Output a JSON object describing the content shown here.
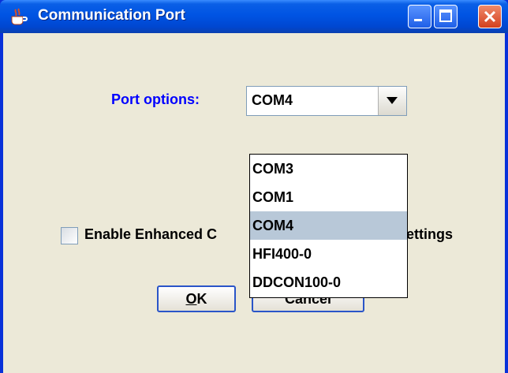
{
  "window": {
    "title": "Communication Port"
  },
  "colors": {
    "title_bar": "#0054e3",
    "port_label": "#0000ff",
    "selected_item": "#b8c8d8",
    "button_border": "#2a55c8"
  },
  "port_options": {
    "label": "Port options:",
    "selected_value": "COM4",
    "options": [
      {
        "label": "COM3",
        "selected": false
      },
      {
        "label": "COM1",
        "selected": false
      },
      {
        "label": "COM4",
        "selected": true
      },
      {
        "label": "HFI400-0",
        "selected": false
      },
      {
        "label": "DDCON100-0",
        "selected": false
      }
    ]
  },
  "enhanced": {
    "label_left": "Enable Enhanced C",
    "label_right": "ettings",
    "checked": false
  },
  "buttons": {
    "ok_mnemonic": "O",
    "ok_rest": "K",
    "cancel": "Cancel"
  }
}
